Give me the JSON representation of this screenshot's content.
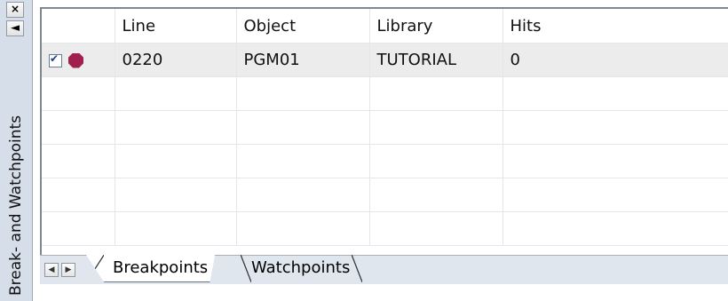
{
  "panel": {
    "title": "Break- and Watchpoints",
    "close_glyph": "×",
    "collapse_glyph": "◄"
  },
  "grid": {
    "columns": [
      "",
      "Line",
      "Object",
      "Library",
      "Hits"
    ],
    "rows": [
      {
        "enabled": true,
        "icon": "breakpoint-stop-icon",
        "line": "0220",
        "object": "PGM01",
        "library": "TUTORIAL",
        "hits": "0"
      }
    ],
    "empty_row_count": 5,
    "breakpoint_color": "#a01f4e"
  },
  "tabs": {
    "nav_left": "◀",
    "nav_right": "▶",
    "items": [
      {
        "label": "Breakpoints",
        "active": true
      },
      {
        "label": "Watchpoints",
        "active": false
      }
    ]
  }
}
